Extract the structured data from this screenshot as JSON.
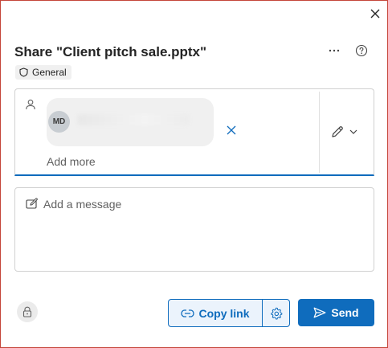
{
  "dialog": {
    "title": "Share \"Client pitch sale.pptx\"",
    "sensitivity_label": "General"
  },
  "recipients": {
    "chips": [
      {
        "initials": "MD",
        "name": ""
      }
    ],
    "add_more_placeholder": "Add more",
    "permission_icon": "pencil-icon"
  },
  "message": {
    "placeholder": "Add a message"
  },
  "footer": {
    "copy_link_label": "Copy link",
    "send_label": "Send"
  },
  "colors": {
    "accent": "#0f6cbd",
    "window_border": "#c4463a"
  }
}
